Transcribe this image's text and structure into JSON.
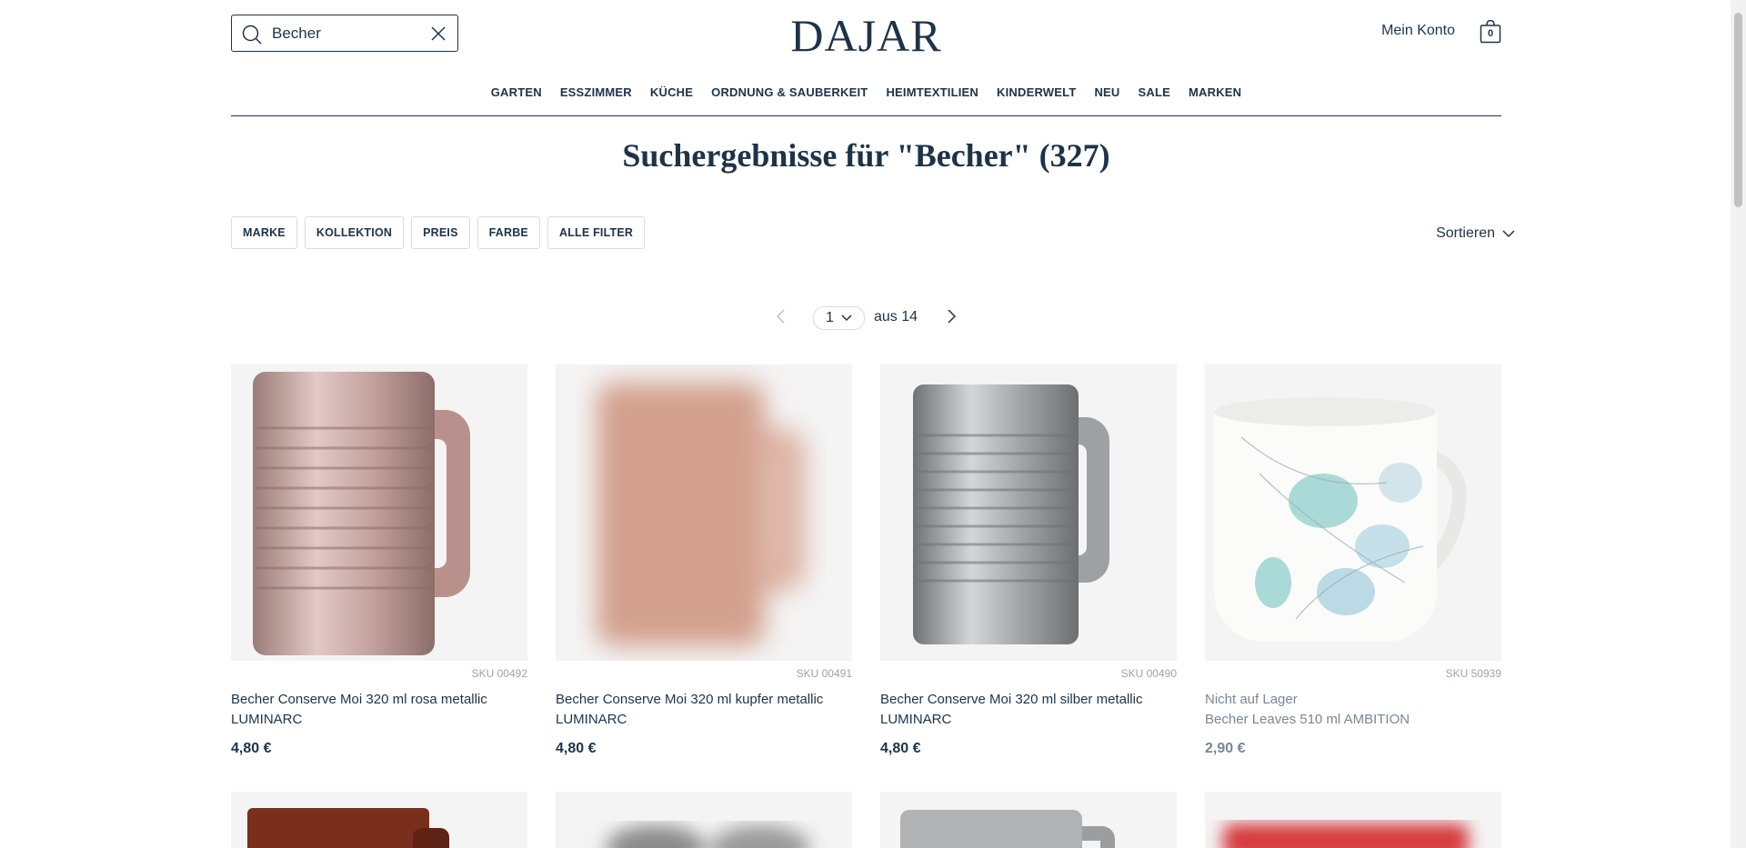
{
  "search": {
    "value": "Becher",
    "placeholder": ""
  },
  "brand": {
    "logo": "DAJAR"
  },
  "header": {
    "account_label": "Mein Konto",
    "cart_count": "0"
  },
  "nav": {
    "items": [
      "GARTEN",
      "ESSZIMMER",
      "KÜCHE",
      "ORDNUNG & SAUBERKEIT",
      "HEIMTEXTILIEN",
      "KINDERWELT",
      "NEU",
      "SALE",
      "MARKEN"
    ]
  },
  "page": {
    "title": "Suchergebnisse für \"Becher\" (327)"
  },
  "filters": {
    "items": [
      "MARKE",
      "KOLLEKTION",
      "PREIS",
      "FARBE",
      "ALLE FILTER"
    ],
    "sort_label": "Sortieren"
  },
  "pagination": {
    "current": "1",
    "of_label": "aus 14"
  },
  "products": [
    {
      "sku": "SKU 00492",
      "name": "Becher Conserve Moi 320 ml rosa metallic LUMINARC",
      "price": "4,80 €",
      "stock": "",
      "color": "#c8a9a6"
    },
    {
      "sku": "SKU 00491",
      "name": "Becher Conserve Moi 320 ml kupfer metallic LUMINARC",
      "price": "4,80 €",
      "stock": "",
      "color": "#d2a08f"
    },
    {
      "sku": "SKU 00490",
      "name": "Becher Conserve Moi 320 ml silber metallic LUMINARC",
      "price": "4,80 €",
      "stock": "",
      "color": "#a6a8ab"
    },
    {
      "sku": "SKU 50939",
      "name": "Becher Leaves 510 ml AMBITION",
      "price": "2,90 €",
      "stock": "Nicht auf Lager",
      "color": "#ffffff"
    }
  ],
  "colors": {
    "primary": "#1d3348",
    "muted": "#7a8794",
    "border": "#d9dde2",
    "image_bg": "#f4f4f4"
  }
}
